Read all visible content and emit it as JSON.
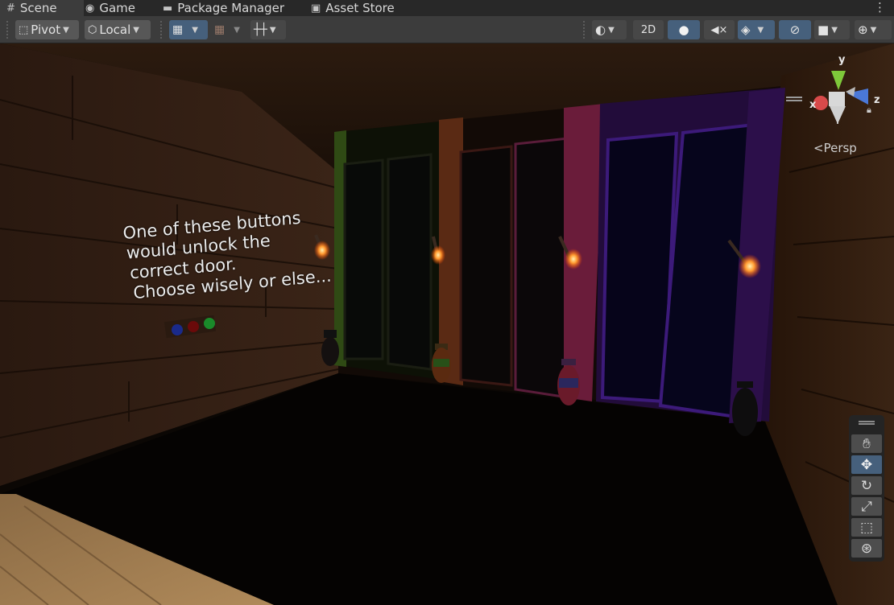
{
  "tabs": [
    {
      "label": "Scene",
      "icon": "hash-icon",
      "active": true
    },
    {
      "label": "Game",
      "icon": "gamepad-icon",
      "active": false
    },
    {
      "label": "Package Manager",
      "icon": "package-icon",
      "active": false
    },
    {
      "label": "Asset Store",
      "icon": "bag-icon",
      "active": false
    }
  ],
  "toolbar": {
    "pivot_label": "Pivot",
    "space_label": "Local",
    "mode_2d_label": "2D"
  },
  "gizmo": {
    "axis_y": "y",
    "axis_x": "x",
    "axis_z": "z",
    "projection_label": "Persp"
  },
  "scene_text": {
    "line1": "One of these buttons",
    "line2": "would unlock the",
    "line3": "correct door.",
    "line4": "Choose wisely or else..."
  },
  "tools": [
    "hand-icon",
    "move-icon",
    "rotate-icon",
    "scale-icon",
    "rect-icon",
    "transform-icon"
  ],
  "colors": {
    "accent": "#46607c",
    "toolbar": "#3c3c3c",
    "tabbar": "#282828"
  }
}
